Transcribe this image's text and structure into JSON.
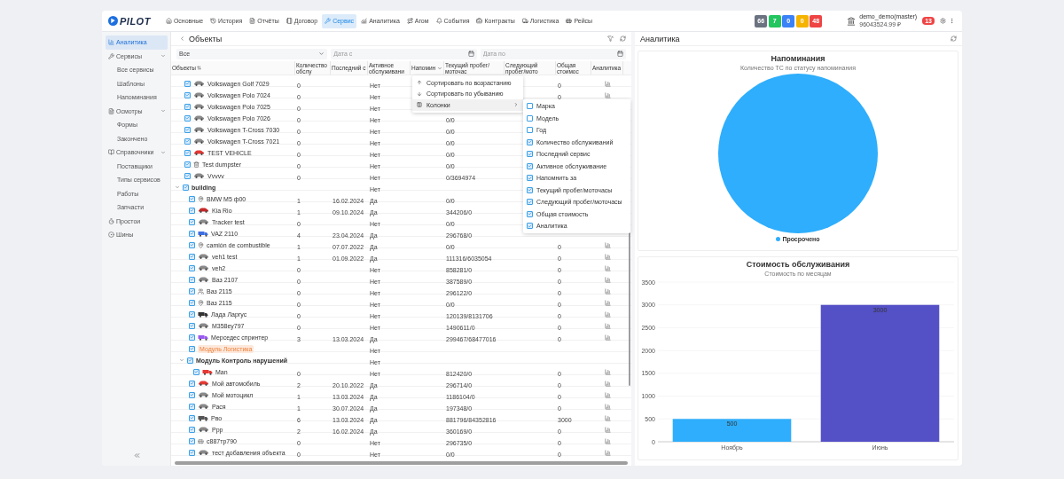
{
  "topbar": {
    "logo": "PILOT",
    "nav": [
      {
        "label": "Основные",
        "selected": false
      },
      {
        "label": "История",
        "selected": false
      },
      {
        "label": "Отчёты",
        "selected": false
      },
      {
        "label": "Договор",
        "selected": false
      },
      {
        "label": "Сервис",
        "selected": true
      },
      {
        "label": "Аналитика",
        "selected": false
      },
      {
        "label": "Агом",
        "selected": false
      },
      {
        "label": "События",
        "selected": false
      },
      {
        "label": "Контракты",
        "selected": false
      },
      {
        "label": "Логистика",
        "selected": false
      },
      {
        "label": "Рейсы",
        "selected": false
      }
    ],
    "badges": [
      {
        "count": "66",
        "color": "#6b7280"
      },
      {
        "count": "7",
        "color": "#22c55e"
      },
      {
        "count": "0",
        "color": "#3b82f6"
      },
      {
        "count": "0",
        "color": "#f5b400"
      },
      {
        "count": "48",
        "color": "#ef4444"
      }
    ],
    "user": {
      "name": "demo_demo(master)",
      "balance": "96043524.99 ₽"
    },
    "notifications": "13"
  },
  "sidebar": {
    "items": [
      {
        "label": "Аналитика",
        "selected": true
      },
      {
        "label": "Сервисы",
        "selected": false,
        "expanded": true,
        "children": [
          {
            "label": "Все сервисы",
            "selected": false
          },
          {
            "label": "Шаблоны",
            "selected": false
          },
          {
            "label": "Напоминания",
            "selected": false
          }
        ]
      },
      {
        "label": "Осмотры",
        "selected": false,
        "expanded": true,
        "children": [
          {
            "label": "Формы",
            "selected": false
          },
          {
            "label": "Закончено",
            "selected": false
          }
        ]
      },
      {
        "label": "Справочники",
        "selected": false,
        "expanded": true,
        "children": [
          {
            "label": "Поставщики",
            "selected": false
          },
          {
            "label": "Типы сервисов",
            "selected": false
          },
          {
            "label": "Работы",
            "selected": false
          },
          {
            "label": "Запчасти",
            "selected": false
          }
        ]
      },
      {
        "label": "Простои",
        "selected": false
      },
      {
        "label": "Шины",
        "selected": false
      }
    ]
  },
  "objects_panel": {
    "title": "Объекты",
    "filters": {
      "type_select": {
        "value": "Все"
      },
      "date_from": {
        "placeholder": "Дата с"
      },
      "date_to": {
        "placeholder": "Дата по"
      }
    },
    "columns": [
      "Объекты",
      "Количество обслу",
      "Последний с",
      "Активное обслуживани",
      "Напомин",
      "Текущий пробег/моточас",
      "Следующий пробег/мото",
      "Общая стоимос",
      "Аналитика"
    ],
    "rows": [
      {
        "kind": "car",
        "color": "#8a8a8a",
        "name": "Volkswagen Golf 7029",
        "checked": true,
        "count": "0",
        "active": "Нет",
        "cost": "0"
      },
      {
        "kind": "car",
        "color": "#8a8a8a",
        "name": "Volkswagen Polo 7024",
        "checked": true,
        "count": "0",
        "active": "Нет",
        "cost": "0"
      },
      {
        "kind": "car",
        "color": "#8a8a8a",
        "name": "Volkswagen Polo 7025",
        "checked": true,
        "count": "0",
        "active": "Нет"
      },
      {
        "kind": "car",
        "color": "#8a8a8a",
        "name": "Volkswagen Polo 7026",
        "checked": true,
        "count": "0",
        "active": "Нет",
        "mileage": "0/0"
      },
      {
        "kind": "car",
        "color": "#8a8a8a",
        "name": "Volkswagen T-Cross 7030",
        "checked": true,
        "count": "0",
        "active": "Нет",
        "mileage": "0/0"
      },
      {
        "kind": "car",
        "color": "#8a8a8a",
        "name": "Volkswagen T-Cross 7021",
        "checked": true,
        "count": "0",
        "active": "Нет",
        "mileage": "0/0"
      },
      {
        "kind": "car",
        "color": "#e53935",
        "name": "TEST VEHICLE",
        "checked": true,
        "count": "0",
        "active": "Нет",
        "mileage": "0/0"
      },
      {
        "kind": "dumpster",
        "name": "Test dumpster",
        "checked": true,
        "count": "0",
        "active": "Нет",
        "mileage": "0/0"
      },
      {
        "kind": "car",
        "color": "#8a8a8a",
        "name": "Vvvvv",
        "checked": true,
        "count": "0",
        "active": "Нет",
        "mileage": "0/3694974"
      },
      {
        "kind": "group",
        "name": "building",
        "checked": true,
        "expanded": true,
        "active": "Нет",
        "children": [
          {
            "kind": "pin",
            "name": "BMW M5 ф00",
            "checked": true,
            "count": "1",
            "last_service": "16.02.2024",
            "active": "Да",
            "mileage": "0/0"
          },
          {
            "kind": "car",
            "color": "#c62828",
            "name": "Kia Rio",
            "checked": true,
            "count": "1",
            "last_service": "09.10.2024",
            "active": "Да",
            "mileage": "344206/0"
          },
          {
            "kind": "car",
            "color": "#8a8a8a",
            "name": "Tracker test",
            "checked": true,
            "count": "0",
            "active": "Нет",
            "mileage": "0/0"
          },
          {
            "kind": "truck",
            "color": "#3f6fe0",
            "name": "VAZ 2110",
            "checked": true,
            "count": "4",
            "last_service": "23.04.2024",
            "active": "Да",
            "mileage": "296768/0"
          },
          {
            "kind": "pin",
            "name": "camión de combustible",
            "checked": true,
            "count": "1",
            "last_service": "07.07.2022",
            "active": "Да",
            "mileage": "0/0",
            "cost": "0"
          },
          {
            "kind": "car",
            "color": "#8a8a8a",
            "name": "veh1 test",
            "checked": true,
            "count": "1",
            "last_service": "01.09.2022",
            "active": "Да",
            "mileage": "111316/6035054",
            "cost": "0"
          },
          {
            "kind": "car",
            "color": "#8a8a8a",
            "name": "veh2",
            "checked": true,
            "count": "0",
            "active": "Нет",
            "mileage": "858281/0",
            "cost": "0"
          },
          {
            "kind": "car",
            "color": "#8a8a8a",
            "name": "Ваз 2107",
            "checked": true,
            "count": "0",
            "active": "Нет",
            "mileage": "387589/0",
            "cost": "0"
          },
          {
            "kind": "people",
            "name": "Ваз 2115",
            "checked": true,
            "count": "0",
            "active": "Нет",
            "mileage": "296122/0",
            "cost": "0"
          },
          {
            "kind": "pin",
            "name": "Ваз 2115",
            "checked": true,
            "count": "0",
            "active": "Нет",
            "mileage": "0/0",
            "cost": "0"
          },
          {
            "kind": "van",
            "color": "#333333",
            "name": "Лада Ларгус",
            "checked": true,
            "count": "0",
            "active": "Нет",
            "mileage": "120139/8131706",
            "cost": "0"
          },
          {
            "kind": "car",
            "color": "#8a8a8a",
            "name": "М358еу797",
            "checked": true,
            "count": "0",
            "active": "Нет",
            "mileage": "1490611/0",
            "cost": "0"
          },
          {
            "kind": "truck",
            "color": "#9b5cf0",
            "name": "Мерседес спринтер",
            "checked": true,
            "count": "3",
            "last_service": "13.03.2024",
            "active": "Да",
            "mileage": "299467/68477016",
            "cost": "0"
          },
          {
            "kind": "tag",
            "name": "Модуль Логистика",
            "checked": true,
            "active": "Нет"
          },
          {
            "kind": "group",
            "name": "Модуль Контроль нарушений",
            "checked": true,
            "expanded": true,
            "active": "Нет",
            "children": [
              {
                "kind": "truck",
                "color": "#e53935",
                "name": "Man",
                "checked": true,
                "count": "0",
                "active": "Нет",
                "mileage": "812420/0",
                "cost": "0"
              }
            ]
          },
          {
            "kind": "car",
            "color": "#e53935",
            "name": "Мой автомобиль",
            "checked": true,
            "count": "2",
            "last_service": "20.10.2022",
            "active": "Да",
            "mileage": "296714/0",
            "cost": "0"
          },
          {
            "kind": "car",
            "color": "#8a8a8a",
            "name": "Мой мотоцикл",
            "checked": true,
            "count": "1",
            "last_service": "13.03.2024",
            "active": "Да",
            "mileage": "1186104/0",
            "cost": "0"
          },
          {
            "kind": "car",
            "color": "#8a8a8a",
            "name": "Рася",
            "checked": true,
            "count": "1",
            "last_service": "30.07.2024",
            "active": "Да",
            "mileage": "197348/0",
            "cost": "0"
          },
          {
            "kind": "van",
            "color": "#555555",
            "name": "Рво",
            "checked": true,
            "count": "6",
            "last_service": "13.03.2024",
            "active": "Да",
            "mileage": "881796/84352816",
            "cost": "3000"
          },
          {
            "kind": "car",
            "color": "#8a8a8a",
            "name": "Ppp",
            "checked": true,
            "count": "2",
            "last_service": "16.02.2024",
            "active": "Да",
            "mileage": "360169/0",
            "cost": "0"
          },
          {
            "kind": "bus",
            "name": "с887тр790",
            "checked": true,
            "count": "0",
            "active": "Нет",
            "mileage": "296735/0",
            "cost": "0"
          },
          {
            "kind": "car",
            "color": "#8a8a8a",
            "name": "тест добавления объекта",
            "checked": true,
            "count": "0",
            "active": "Нет",
            "mileage": "0/0",
            "cost": "0"
          }
        ]
      }
    ],
    "column_menu": {
      "items": [
        {
          "label": "Сортировать по возрастанию",
          "kind": "sort-asc"
        },
        {
          "label": "Сортировать по убыванию",
          "kind": "sort-desc"
        },
        {
          "label": "Колонки",
          "kind": "submenu",
          "expanded": true
        }
      ],
      "columns_submenu": [
        {
          "label": "Марка",
          "checked": false
        },
        {
          "label": "Модель",
          "checked": false
        },
        {
          "label": "Год",
          "checked": false
        },
        {
          "label": "Количество обслуживаний",
          "checked": true
        },
        {
          "label": "Последний сервис",
          "checked": true
        },
        {
          "label": "Активное обслуживание",
          "checked": true
        },
        {
          "label": "Напомнить за",
          "checked": true
        },
        {
          "label": "Текущий пробег/моточасы",
          "checked": true
        },
        {
          "label": "Следующий пробег/моточасы",
          "checked": true
        },
        {
          "label": "Общая стоимость",
          "checked": true
        },
        {
          "label": "Аналитика",
          "checked": true
        }
      ]
    }
  },
  "analytics_panel": {
    "title": "Аналитика",
    "reminders_card": {
      "title": "Напоминания",
      "subtitle": "Количество ТС по статусу напоминания",
      "legend": [
        {
          "label": "Просрочено",
          "color": "#2eaefc"
        }
      ]
    },
    "cost_card": {
      "subtitle": "Стоимость по месяцам",
      "chart_data": {
        "type": "bar",
        "title": "Стоимость обслуживания",
        "categories": [
          "Ноябрь",
          "Июнь"
        ],
        "values": [
          500,
          3000
        ],
        "colors": [
          "#2eaefc",
          "#5450c6"
        ],
        "ylim": [
          0,
          3500
        ],
        "yticks": [
          0,
          500,
          1000,
          1500,
          2000,
          2500,
          3000,
          3500
        ],
        "grid": true,
        "data_labels": true
      }
    }
  }
}
